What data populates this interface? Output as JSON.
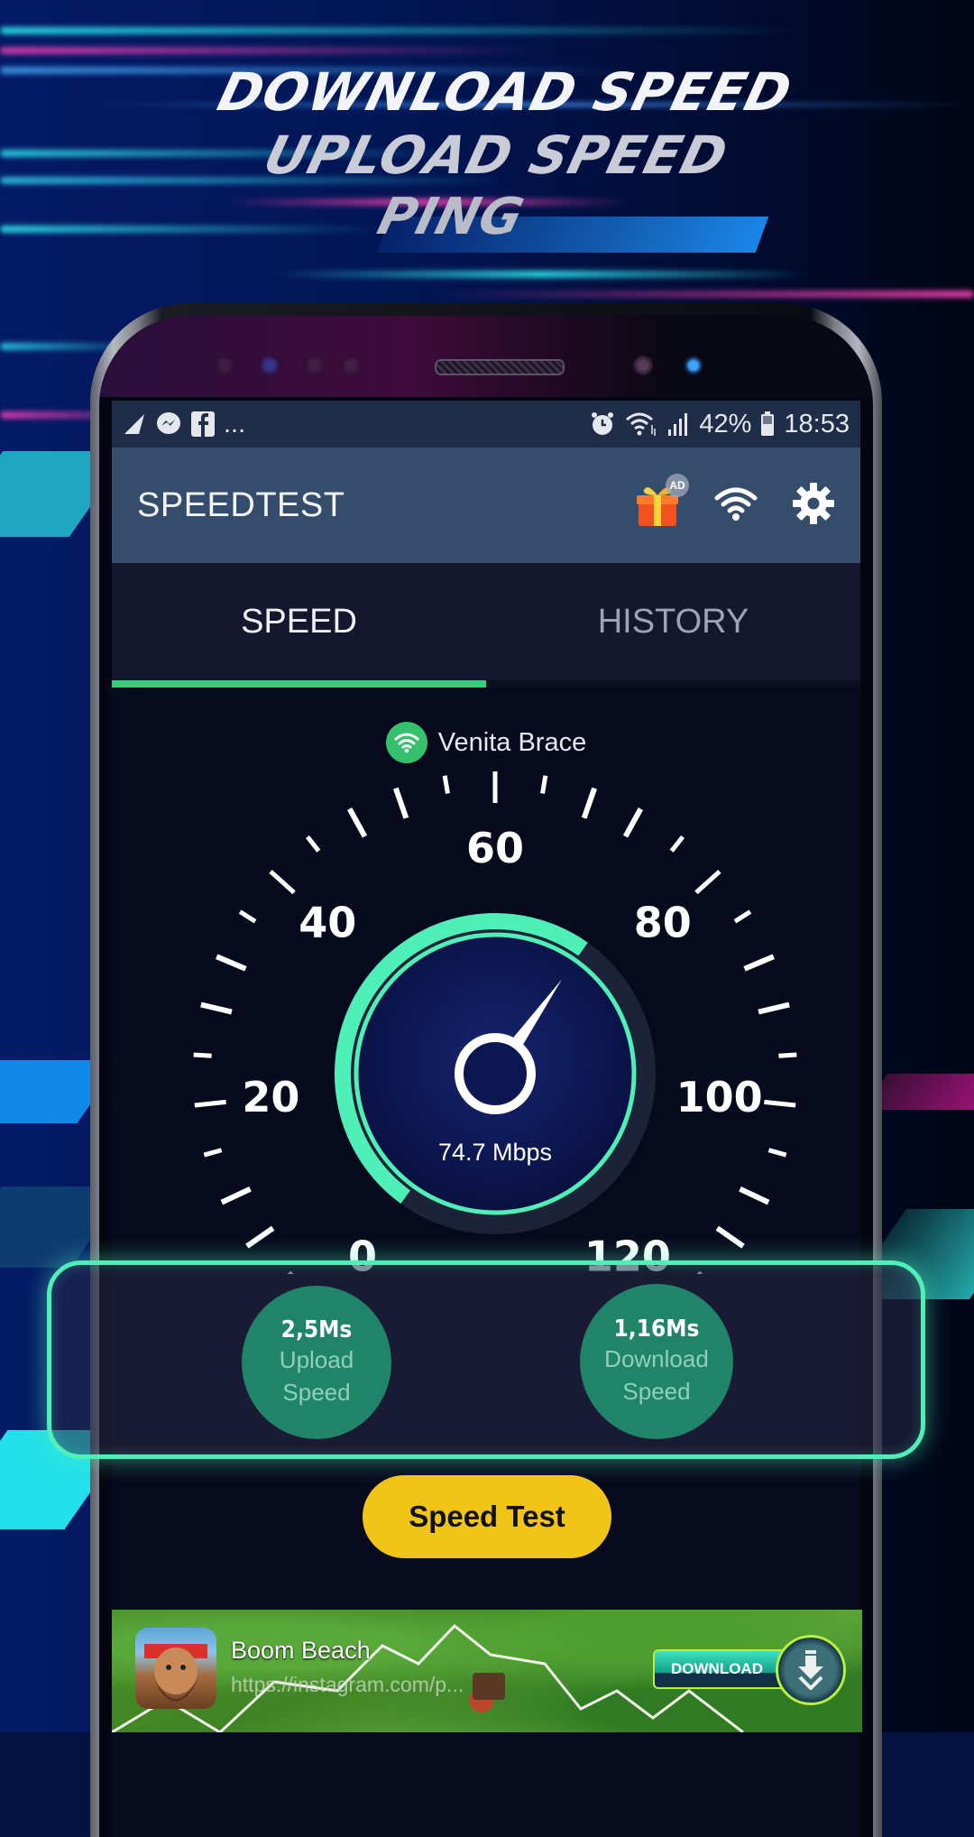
{
  "promo": {
    "headline_lines": [
      "DOWNLOAD SPEED",
      "UPLOAD SPEED",
      "PING"
    ]
  },
  "status_bar": {
    "notification_icons": [
      "navigation-icon",
      "messenger-icon",
      "facebook-icon"
    ],
    "more": "...",
    "battery_percent": "42%",
    "time": "18:53",
    "system_icons": [
      "alarm-icon",
      "wifi-icon",
      "signal-icon",
      "battery-icon"
    ]
  },
  "app_bar": {
    "title": "SPEEDTEST",
    "ad_badge": "AD",
    "icons": [
      "gift-icon",
      "wifi-icon",
      "gear-icon"
    ]
  },
  "tabs": [
    {
      "label": "SPEED",
      "active": true
    },
    {
      "label": "HISTORY",
      "active": false
    }
  ],
  "network": {
    "name": "Venita Brace",
    "icon": "wifi-icon",
    "accent": "#35c06d"
  },
  "gauge": {
    "labels": [
      "0",
      "20",
      "40",
      "60",
      "80",
      "100",
      "120"
    ],
    "min": 0,
    "max": 120,
    "value": 74.7,
    "readout": "74.7 Mbps",
    "ring_color": "#4ff0b8"
  },
  "stats": [
    {
      "value": "2,5Ms",
      "label_line1": "Upload",
      "label_line2": "Speed"
    },
    {
      "value": "1,16Ms",
      "label_line1": "Download",
      "label_line2": "Speed"
    }
  ],
  "speed_test_button": {
    "label": "Speed Test",
    "color": "#f1c418"
  },
  "ad_banner": {
    "title": "Boom Beach",
    "url": "https://instagram.com/p...",
    "cta": "DOWNLOAD"
  },
  "colors": {
    "accent_green": "#35cc7a",
    "highlight": "#4ff0b8",
    "app_bar": "#364c6b",
    "stat_circle": "#1f8468"
  }
}
